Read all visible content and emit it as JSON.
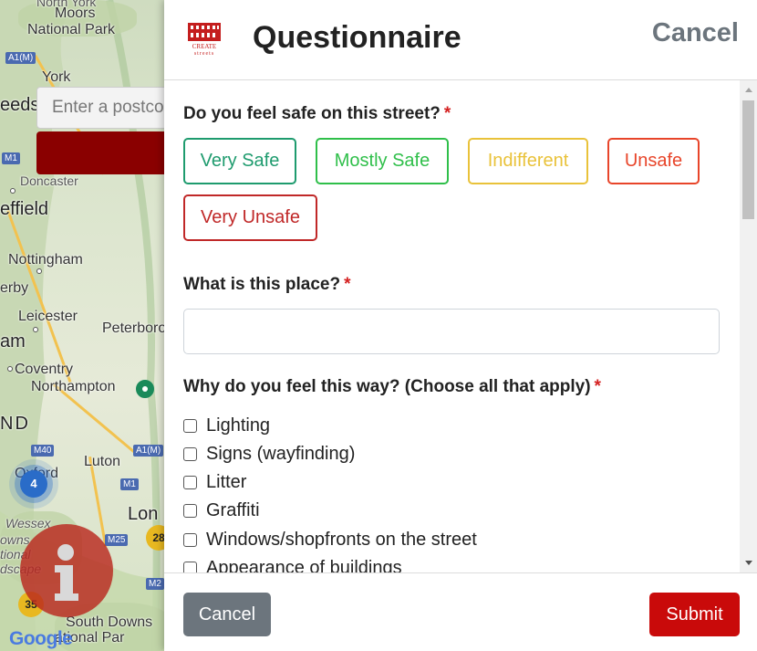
{
  "map": {
    "places": [
      "Moors",
      "National Park",
      "York",
      "eeds",
      "Doncaster",
      "effield",
      "Nottingham",
      "erby",
      "Leicester",
      "Peterboro",
      "am",
      "Coventry",
      "Northampton",
      "ND",
      "Luton",
      "Oxford",
      "Lon",
      "Wessex",
      "owns",
      "tional",
      "dscape",
      "South Downs",
      "ational Par",
      "North York"
    ],
    "shields": [
      "A1(M)",
      "M1",
      "M40",
      "A1(M)",
      "M1",
      "M25",
      "M2",
      "M1"
    ],
    "clusters": [
      "4",
      "28",
      "35"
    ],
    "postcode_placeholder": "Enter a postcode",
    "brand": "Google"
  },
  "modal": {
    "logo_text_top": "CREATE",
    "logo_text_bottom": "streets",
    "title": "Questionnaire",
    "header_cancel": "Cancel",
    "q1": {
      "label": "Do you feel safe on this street?",
      "required": "*",
      "options": [
        {
          "label": "Very Safe",
          "color": "#1e9b6e"
        },
        {
          "label": "Mostly Safe",
          "color": "#2fbf4a"
        },
        {
          "label": "Indifferent",
          "color": "#e9c23a"
        },
        {
          "label": "Unsafe",
          "color": "#e8452a"
        },
        {
          "label": "Very Unsafe",
          "color": "#c02828"
        }
      ]
    },
    "q2": {
      "label": "What is this place?",
      "required": "*",
      "value": ""
    },
    "q3": {
      "label": "Why do you feel this way? (Choose all that apply)",
      "required": "*",
      "options": [
        "Lighting",
        "Signs (wayfinding)",
        "Litter",
        "Graffiti",
        "Windows/shopfronts on the street",
        "Appearance of buildings"
      ]
    },
    "footer": {
      "cancel_label": "Cancel",
      "submit_label": "Submit"
    }
  },
  "colors": {
    "submit": "#c90a0a",
    "cancel": "#6c757d",
    "required": "#d42020"
  }
}
